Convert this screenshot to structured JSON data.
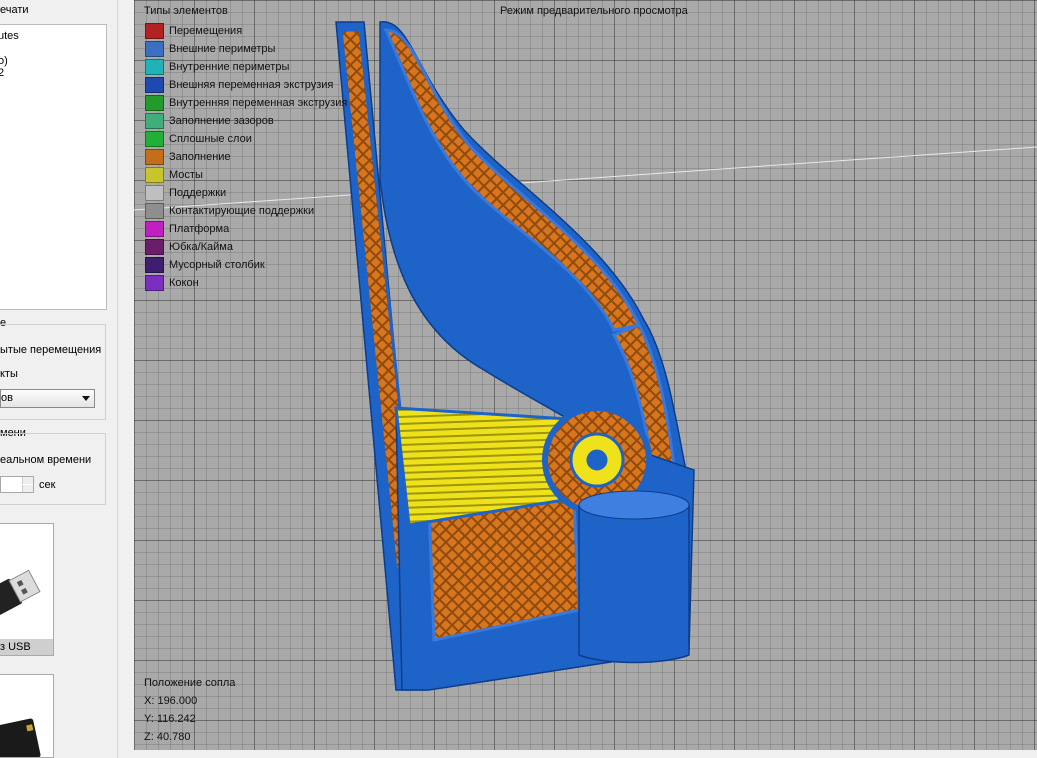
{
  "left_panel": {
    "print_group_title": "ечати",
    "list_items": [
      "utes",
      "о)",
      "2"
    ],
    "display_group_title": "е",
    "display_opt1": "ытые перемещения",
    "display_opt2": "кты",
    "combo_value": "ов",
    "realtime_group_title": "мени",
    "realtime_opt": "еальном времени",
    "seconds_unit": "сек",
    "usb_card_label": "з USB"
  },
  "viewport": {
    "title": "Режим предварительного просмотра",
    "legend_title": "Типы элементов",
    "legend": [
      {
        "label": "Перемещения",
        "color": "#b22222"
      },
      {
        "label": "Внешние периметры",
        "color": "#3a6fc1"
      },
      {
        "label": "Внутренние периметры",
        "color": "#1fb2b8"
      },
      {
        "label": "Внешняя переменная экструзия",
        "color": "#2049b0"
      },
      {
        "label": "Внутренняя переменная экструзия",
        "color": "#239a2c"
      },
      {
        "label": "Заполнение зазоров",
        "color": "#3fae7a"
      },
      {
        "label": "Сплошные слои",
        "color": "#20b038"
      },
      {
        "label": "Заполнение",
        "color": "#c46d1a"
      },
      {
        "label": "Мосты",
        "color": "#c8c42e"
      },
      {
        "label": "Поддержки",
        "color": "#bfbfbf"
      },
      {
        "label": "Контактирующие поддержки",
        "color": "#8e8e8e"
      },
      {
        "label": "Платформа",
        "color": "#c020c0"
      },
      {
        "label": "Юбка/Кайма",
        "color": "#6a1e6a"
      },
      {
        "label": "Мусорный столбик",
        "color": "#3e1e6e"
      },
      {
        "label": "Кокон",
        "color": "#7a2fc0"
      }
    ],
    "nozzle_title": "Положение сопла",
    "nozzle_x": "X: 196.000",
    "nozzle_y": "Y: 116.242",
    "nozzle_z": "Z: 40.780"
  }
}
